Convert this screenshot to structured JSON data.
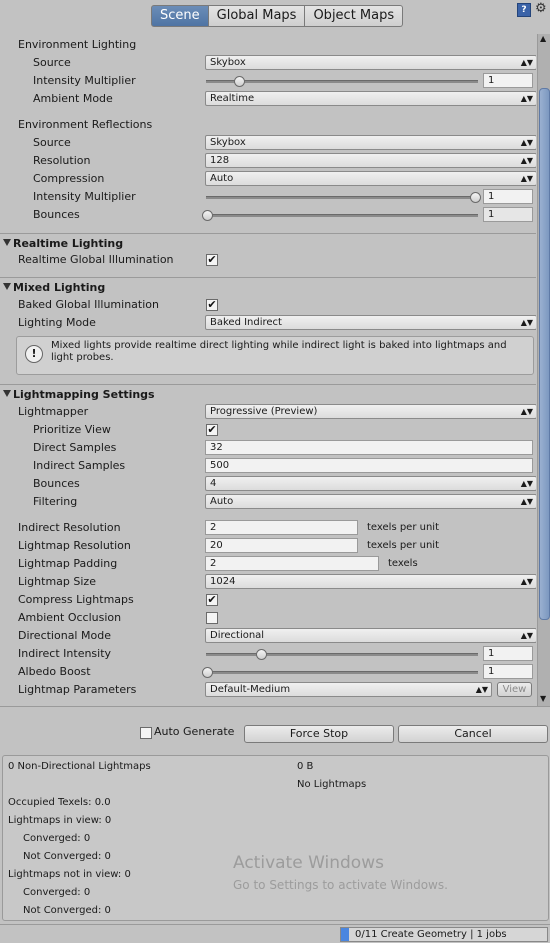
{
  "tabs": [
    "Scene",
    "Global Maps",
    "Object Maps"
  ],
  "env_lighting": {
    "header": "Environment Lighting",
    "source_label": "Source",
    "source_value": "Skybox",
    "intensity_label": "Intensity Multiplier",
    "intensity_value": "1",
    "intensity_fraction": 0.12,
    "ambient_label": "Ambient Mode",
    "ambient_value": "Realtime"
  },
  "env_reflections": {
    "header": "Environment Reflections",
    "source_label": "Source",
    "source_value": "Skybox",
    "resolution_label": "Resolution",
    "resolution_value": "128",
    "compression_label": "Compression",
    "compression_value": "Auto",
    "intensity_label": "Intensity Multiplier",
    "intensity_value": "1",
    "intensity_fraction": 1.0,
    "bounces_label": "Bounces",
    "bounces_value": "1",
    "bounces_fraction": 0.0
  },
  "realtime": {
    "title": "Realtime Lighting",
    "gi_label": "Realtime Global Illumination",
    "gi_checked": true
  },
  "mixed": {
    "title": "Mixed Lighting",
    "baked_label": "Baked Global Illumination",
    "baked_checked": true,
    "mode_label": "Lighting Mode",
    "mode_value": "Baked Indirect",
    "help_text": "Mixed lights provide realtime direct lighting while indirect light is baked into lightmaps and light probes."
  },
  "lightmapping": {
    "title": "Lightmapping Settings",
    "lightmapper_label": "Lightmapper",
    "lightmapper_value": "Progressive (Preview)",
    "prioritize_label": "Prioritize View",
    "prioritize_checked": true,
    "direct_label": "Direct Samples",
    "direct_value": "32",
    "indirect_label": "Indirect Samples",
    "indirect_value": "500",
    "bounces_label": "Bounces",
    "bounces_value": "4",
    "filtering_label": "Filtering",
    "filtering_value": "Auto",
    "indirect_res_label": "Indirect Resolution",
    "indirect_res_value": "2",
    "indirect_res_unit": "texels per unit",
    "lm_res_label": "Lightmap Resolution",
    "lm_res_value": "20",
    "lm_res_unit": "texels per unit",
    "padding_label": "Lightmap Padding",
    "padding_value": "2",
    "padding_unit": "texels",
    "size_label": "Lightmap Size",
    "size_value": "1024",
    "compress_label": "Compress Lightmaps",
    "compress_checked": true,
    "ao_label": "Ambient Occlusion",
    "ao_checked": false,
    "dir_label": "Directional Mode",
    "dir_value": "Directional",
    "ind_int_label": "Indirect Intensity",
    "ind_int_value": "1",
    "ind_int_fraction": 0.2,
    "albedo_label": "Albedo Boost",
    "albedo_value": "1",
    "albedo_fraction": 0.0,
    "params_label": "Lightmap Parameters",
    "params_value": "Default-Medium",
    "view_button": "View"
  },
  "bottom": {
    "auto_generate_label": "Auto Generate",
    "force_stop_label": "Force Stop",
    "cancel_label": "Cancel"
  },
  "stats": {
    "non_directional": "0 Non-Directional Lightmaps",
    "size": "0 B",
    "no_lightmaps": "No Lightmaps",
    "occupied": "Occupied Texels: 0.0",
    "in_view": "Lightmaps in view: 0",
    "in_view_converged": "Converged: 0",
    "in_view_not_converged": "Not Converged: 0",
    "not_in_view": "Lightmaps not in view: 0",
    "not_in_view_converged": "Converged: 0",
    "not_in_view_not_converged": "Not Converged: 0"
  },
  "watermark": {
    "line1": "Activate Windows",
    "line2": "Go to Settings to activate Windows."
  },
  "status": {
    "progress_text": "0/11 Create Geometry | 1 jobs",
    "progress_fraction": 0.0
  }
}
